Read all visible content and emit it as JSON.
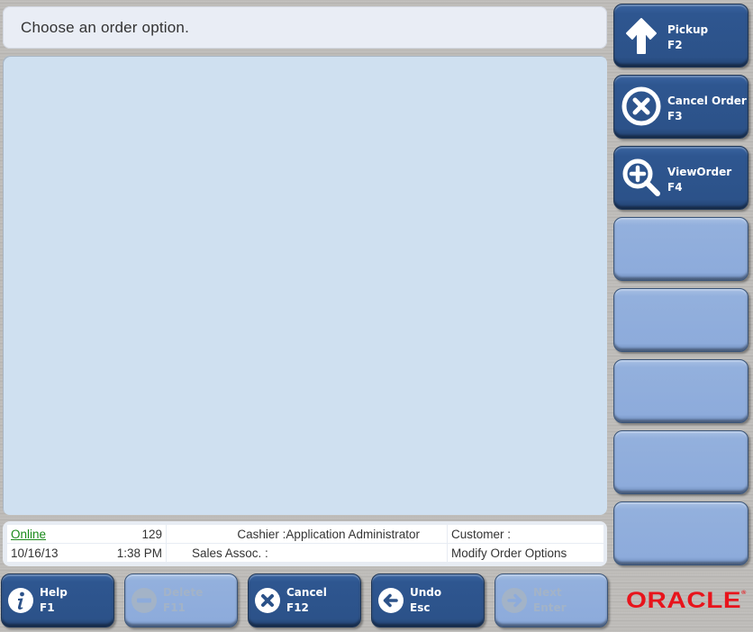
{
  "prompt": {
    "text": "Choose an order option."
  },
  "status": {
    "connection": "Online",
    "register_number": "129",
    "cashier": "Cashier :Application Administrator",
    "customer": "Customer :",
    "date": "10/16/13",
    "time": "1:38 PM",
    "sales_assoc": "Sales Assoc. :",
    "context": "Modify Order Options"
  },
  "side_buttons": [
    {
      "label": "Pickup\nF2",
      "icon": "arrow-up-icon",
      "state": "active"
    },
    {
      "label": "Cancel Order\nF3",
      "icon": "cancel-circle-icon",
      "state": "active"
    },
    {
      "label": "ViewOrder\nF4",
      "icon": "magnify-plus-icon",
      "state": "active"
    },
    {
      "label": "",
      "state": "blank"
    },
    {
      "label": "",
      "state": "blank"
    },
    {
      "label": "",
      "state": "blank"
    },
    {
      "label": "",
      "state": "blank"
    },
    {
      "label": "",
      "state": "blank"
    }
  ],
  "bottom_buttons": [
    {
      "label": "Help\nF1",
      "icon": "info-icon",
      "state": "active"
    },
    {
      "label": "Delete\nF11",
      "icon": "minus-circle-icon",
      "state": "disabled"
    },
    {
      "label": "Cancel\nF12",
      "icon": "cancel-circle-icon",
      "state": "active"
    },
    {
      "label": "Undo\nEsc",
      "icon": "arrow-left-circle-icon",
      "state": "active"
    },
    {
      "label": "Next\nEnter",
      "icon": "arrow-right-circle-icon",
      "state": "disabled"
    }
  ],
  "brand": {
    "logo_text": "ORACLE",
    "logo_mark": "®",
    "color": "#e8141c"
  },
  "colors": {
    "active_button": "#2c5289",
    "blank_button": "#8dabdb",
    "work_area": "#cfe0f0",
    "online_link": "#1a8a1a"
  }
}
